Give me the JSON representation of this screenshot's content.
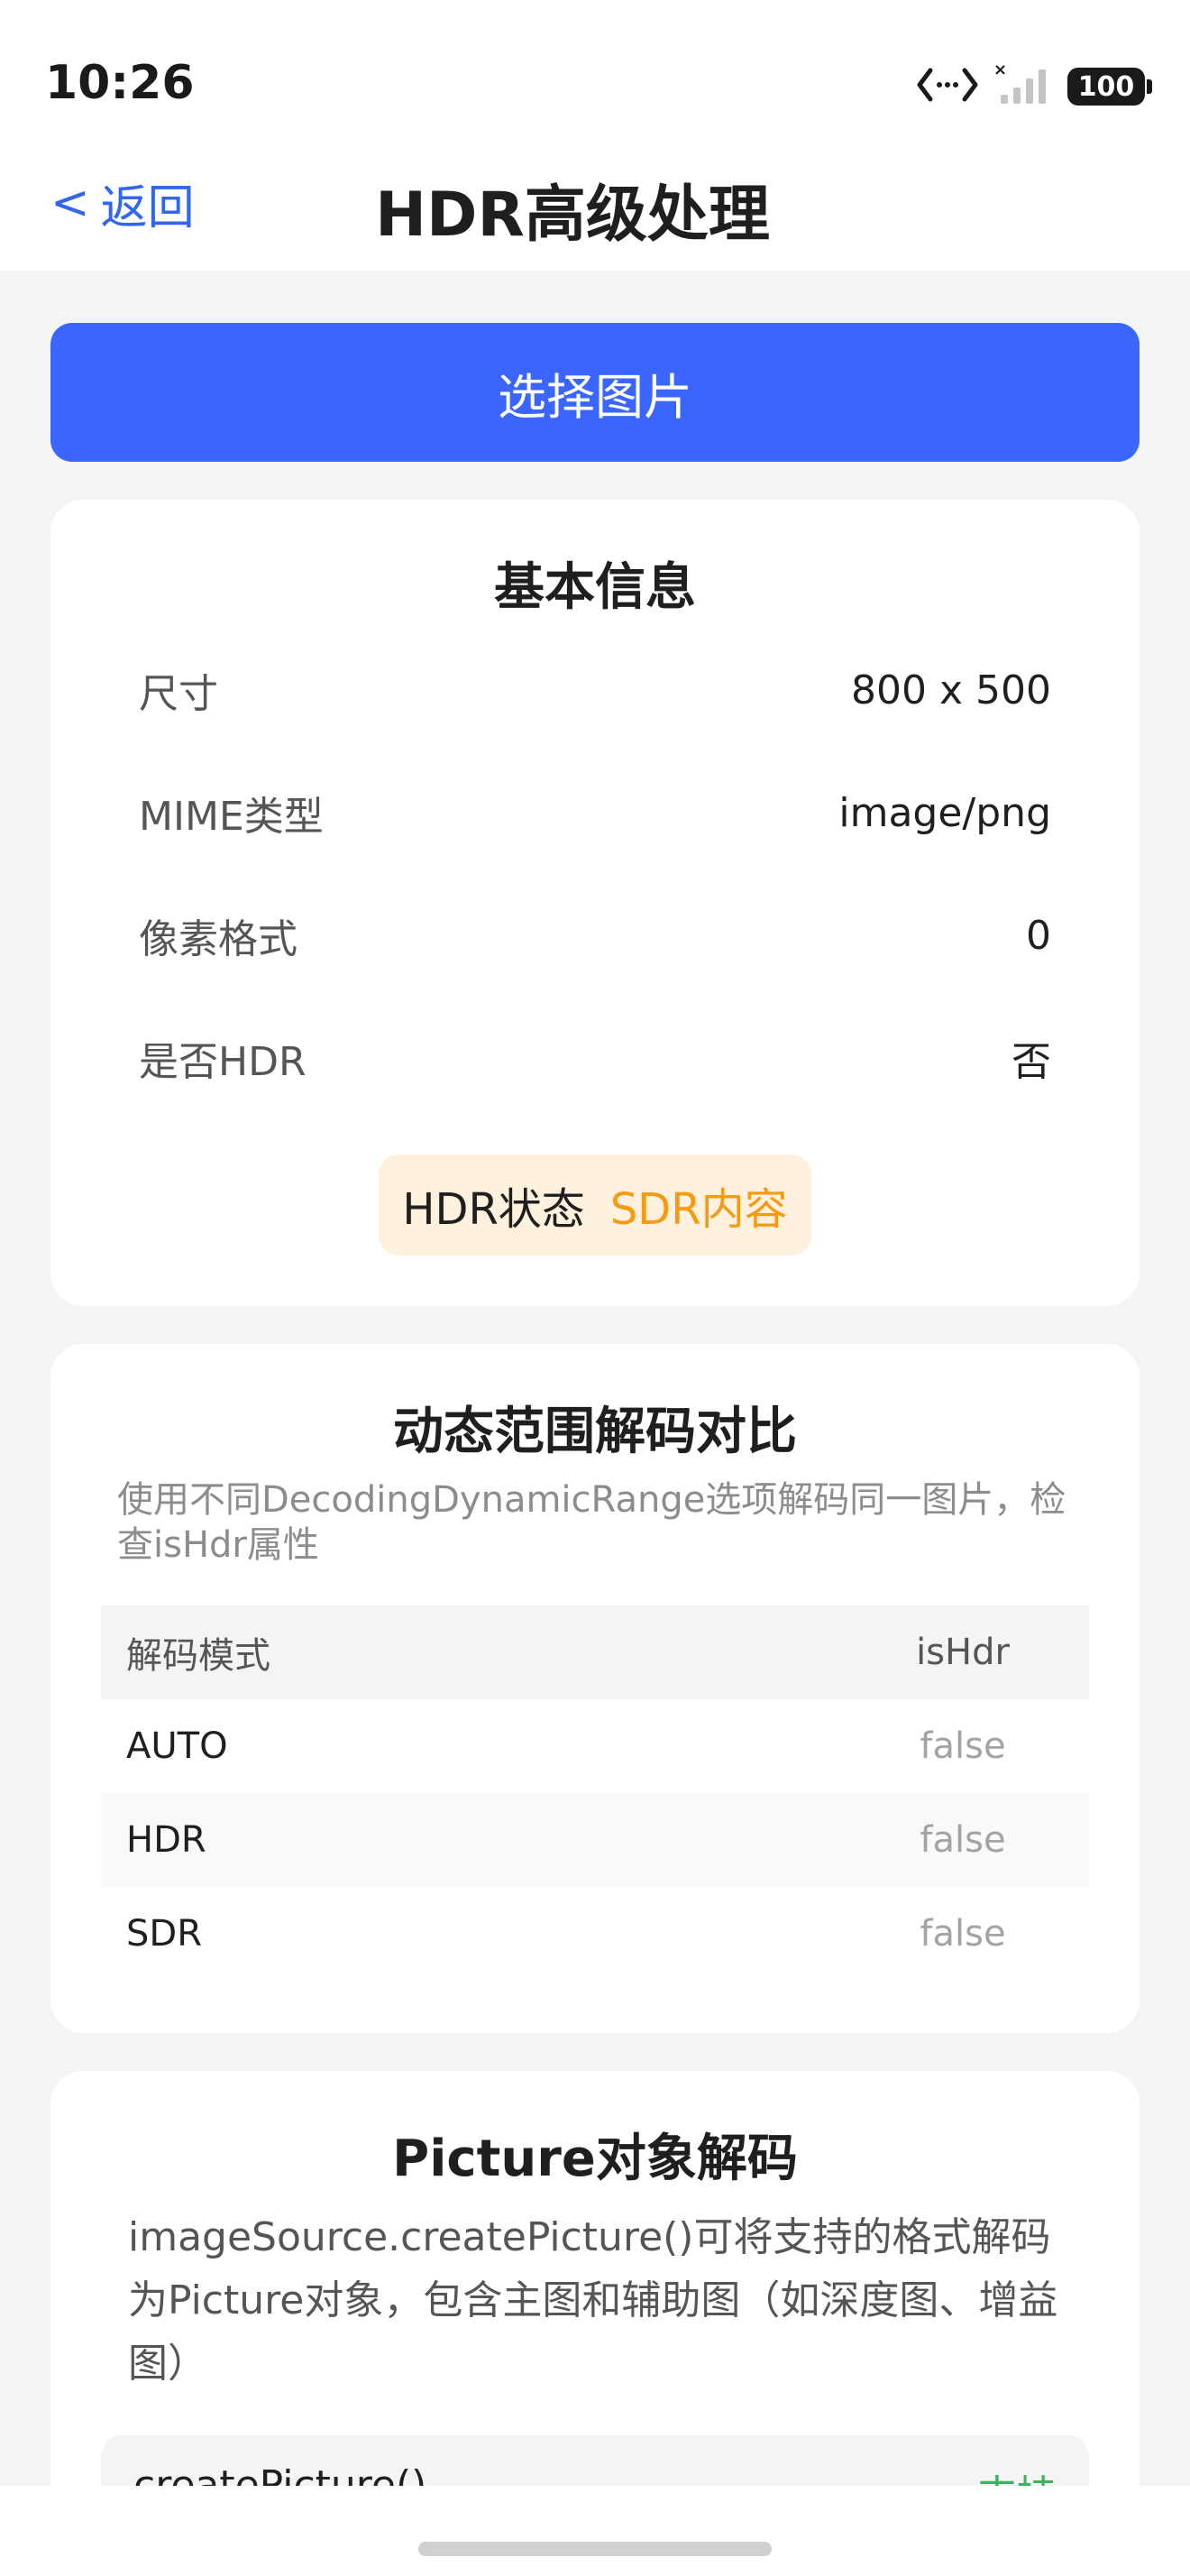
{
  "status_bar": {
    "time": "10:26",
    "battery": "100",
    "icons": [
      "code-brackets-icon",
      "signal-off-icon",
      "battery-icon"
    ]
  },
  "nav": {
    "back_symbol": "<",
    "back_label": "返回",
    "title": "HDR高级处理"
  },
  "select_button": "选择图片",
  "basic_info": {
    "title": "基本信息",
    "rows": [
      {
        "label": "尺寸",
        "value": "800 x 500"
      },
      {
        "label": "MIME类型",
        "value": "image/png"
      },
      {
        "label": "像素格式",
        "value": "0"
      },
      {
        "label": "是否HDR",
        "value": "否"
      }
    ],
    "hdr_status_label": "HDR状态",
    "hdr_status_value": "SDR内容"
  },
  "dynamic_range": {
    "title": "动态范围解码对比",
    "description": "使用不同DecodingDynamicRange选项解码同一图片，检查isHdr属性",
    "columns": [
      "解码模式",
      "isHdr"
    ],
    "rows": [
      {
        "mode": "AUTO",
        "is_hdr": "false"
      },
      {
        "mode": "HDR",
        "is_hdr": "false"
      },
      {
        "mode": "SDR",
        "is_hdr": "false"
      }
    ]
  },
  "picture": {
    "title": "Picture对象解码",
    "description": "imageSource.createPicture()可将支持的格式解码为Picture对象，包含主图和辅助图（如深度图、增益图）",
    "row_label": "createPicture()",
    "row_value": "支持"
  },
  "colors": {
    "accent": "#3a66ff",
    "back_link": "#3366ee",
    "sdr_text": "#f59a14",
    "sdr_bg": "#fff1de",
    "support": "#3bb25b"
  }
}
